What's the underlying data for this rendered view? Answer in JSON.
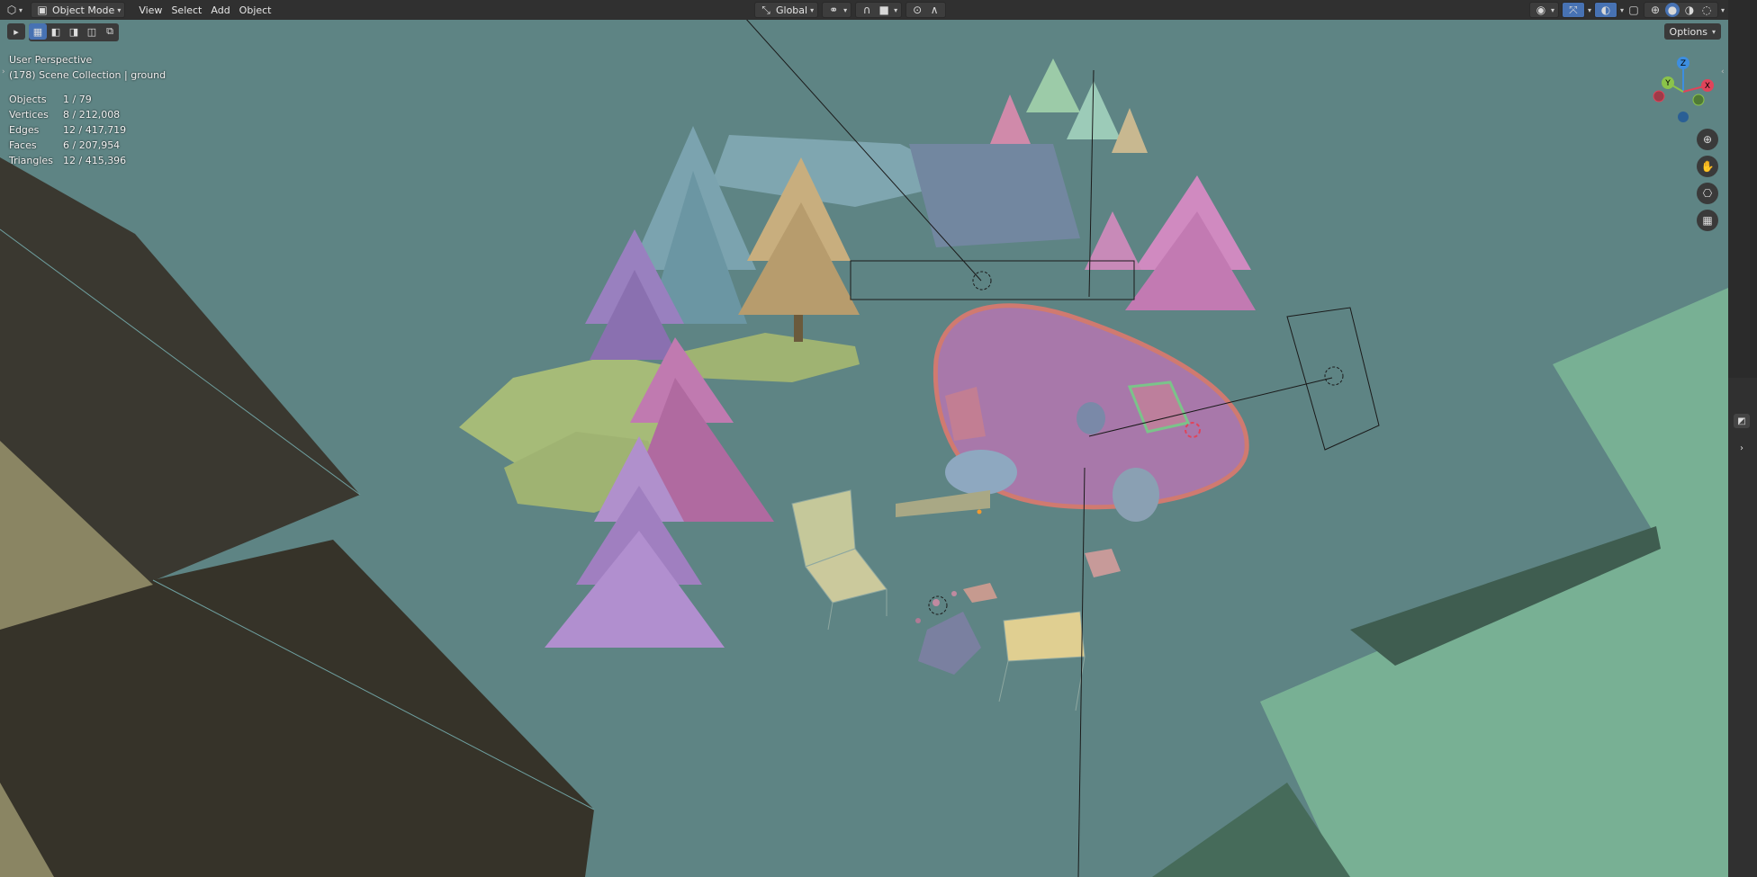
{
  "header": {
    "editor_type_icon": "editor-type-icon",
    "mode_label": "Object Mode",
    "menus": [
      "View",
      "Select",
      "Add",
      "Object"
    ],
    "transform_orientation": "Global",
    "pivot_icon": "pivot-icon",
    "snap_icon": "magnet-icon",
    "proportional_icon": "proportional-edit-icon",
    "viewport_shading_icons": [
      "wireframe-icon",
      "solid-icon",
      "material-icon",
      "rendered-icon"
    ]
  },
  "toolbar": {
    "select_tools": [
      "select-box-icon",
      "select-new-icon",
      "select-extend-icon",
      "select-subtract-icon",
      "select-intersect-icon"
    ]
  },
  "overlay": {
    "view_name": "User Perspective",
    "collection": "(178) Scene Collection | ground",
    "stats": [
      {
        "label": "Objects",
        "value": "1 / 79"
      },
      {
        "label": "Vertices",
        "value": "8 / 212,008"
      },
      {
        "label": "Edges",
        "value": "12 / 417,719"
      },
      {
        "label": "Faces",
        "value": "6 / 207,954"
      },
      {
        "label": "Triangles",
        "value": "12 / 415,396"
      }
    ]
  },
  "options_label": "Options",
  "gizmo": {
    "x": "X",
    "y": "Y",
    "z": "Z"
  },
  "colors": {
    "viewport_bg": "#5e8484",
    "header_bg": "#303030",
    "active_blue": "#4772b3",
    "axis_x": "#e0445a",
    "axis_y": "#8bc34a",
    "axis_z": "#3d8ee0"
  }
}
